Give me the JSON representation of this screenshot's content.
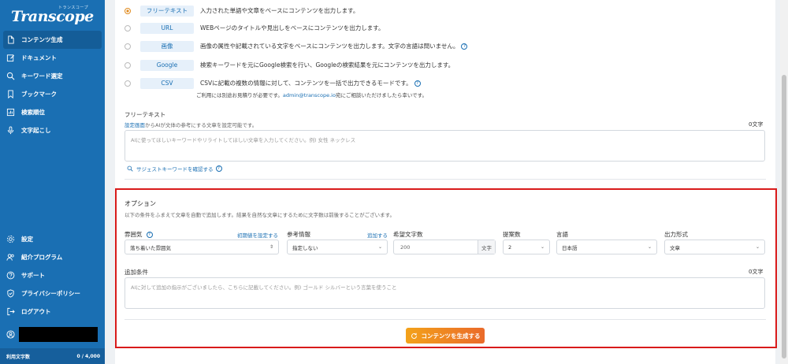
{
  "sidebar": {
    "logo_sub": "トランスコープ",
    "logo_main": "Transcope",
    "top_items": [
      {
        "label": "コンテンツ生成",
        "icon": "document-icon"
      },
      {
        "label": "ドキュメント",
        "icon": "edit-icon"
      },
      {
        "label": "キーワード選定",
        "icon": "search-icon"
      },
      {
        "label": "ブックマーク",
        "icon": "bookmark-icon"
      },
      {
        "label": "検索順位",
        "icon": "chart-icon"
      },
      {
        "label": "文字起こし",
        "icon": "mic-icon"
      }
    ],
    "bottom_items": [
      {
        "label": "設定",
        "icon": "gear-icon"
      },
      {
        "label": "紹介プログラム",
        "icon": "users-icon"
      },
      {
        "label": "サポート",
        "icon": "help-icon"
      },
      {
        "label": "プライバシーポリシー",
        "icon": "shield-icon"
      },
      {
        "label": "ログアウト",
        "icon": "logout-icon"
      }
    ],
    "usage_label": "利用文字数",
    "usage_value": "0 / 4,000"
  },
  "modes": [
    {
      "chip": "フリーテキスト",
      "desc": "入力された単語や文章をベースにコンテンツを出力します。",
      "checked": true,
      "help": false
    },
    {
      "chip": "URL",
      "desc": "WEBページのタイトルや見出しをベースにコンテンツを出力します。",
      "checked": false,
      "help": false
    },
    {
      "chip": "画像",
      "desc": "画像の属性や記載されている文字をベースにコンテンツを出力します。文字の言語は問いません。",
      "checked": false,
      "help": true
    },
    {
      "chip": "Google",
      "desc": "検索キーワードを元にGoogle検索を行い、Googleの検索結果を元にコンテンツを出力します。",
      "checked": false,
      "help": false
    },
    {
      "chip": "CSV",
      "desc": "CSVに記載の複数の情報に対して、コンテンツを一括で出力できるモードです。",
      "checked": false,
      "help": true
    }
  ],
  "csv_note": {
    "pre": "ご利用には別途お見積りが必要です。",
    "email": "admin@transcope.io",
    "post": "宛にご相談いただけましたら幸いです。"
  },
  "freetext": {
    "label": "フリーテキスト",
    "sub_link": "設定画面",
    "sub_rest": "からAIが文体の参考にする文章を設定可能です。",
    "counter": "0文字",
    "placeholder": "AIに使ってほしいキーワードやリライトしてほしい文章を入力してください。例) 女性 ネックレス",
    "suggest": "サジェストキーワードを確認する"
  },
  "options": {
    "title": "オプション",
    "sub": "以下の条件をふまえて文章を自動で追加します。結果を自然な文章にするために文字数は前後することがございます。",
    "mood": {
      "label": "雰囲気",
      "link": "初期値を設定する",
      "value": "落ち着いた雰囲気"
    },
    "reference": {
      "label": "参考情報",
      "link": "追加する",
      "value": "指定しない"
    },
    "chars": {
      "label": "希望文字数",
      "value": "200",
      "unit": "文字"
    },
    "count": {
      "label": "提案数",
      "value": "2"
    },
    "language": {
      "label": "言語",
      "value": "日本語"
    },
    "format": {
      "label": "出力形式",
      "value": "文章"
    },
    "extra": {
      "label": "追加条件",
      "counter": "0文字",
      "placeholder": "AIに対して追加の指示がございましたら、こちらに記載してください。例) ゴールド シルバーという言葉を使うこと"
    },
    "generate_label": "コンテンツを生成する"
  }
}
